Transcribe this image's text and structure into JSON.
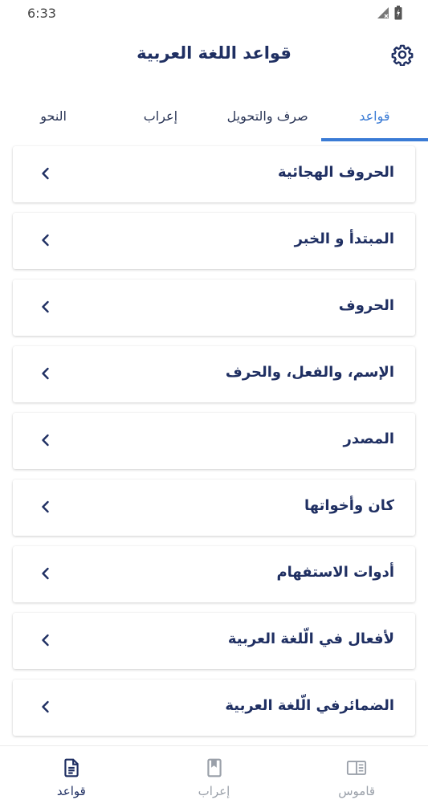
{
  "status": {
    "time": "6:33"
  },
  "app": {
    "title": "قواعد اللغة العربية"
  },
  "tabs": [
    {
      "label": "قواعد",
      "active": true
    },
    {
      "label": "صرف والتحويل",
      "active": false
    },
    {
      "label": "إعراب",
      "active": false
    },
    {
      "label": "النحو",
      "active": false
    }
  ],
  "items": [
    {
      "label": "الحروف الهجائية"
    },
    {
      "label": "المبتدأ و الخبر"
    },
    {
      "label": "الحروف"
    },
    {
      "label": "الإسم، والفعل، والحرف"
    },
    {
      "label": "المصدر"
    },
    {
      "label": "كان وأخواتها"
    },
    {
      "label": "أدوات الاستفهام"
    },
    {
      "label": "لأفعال في الّلغة العربية"
    },
    {
      "label": "الضمائرفي الّلغة العربية"
    }
  ],
  "bottom_nav": [
    {
      "label": "قاموس",
      "icon": "dictionary-icon",
      "active": false
    },
    {
      "label": "إعراب",
      "icon": "bookmark-book-icon",
      "active": false
    },
    {
      "label": "قواعد",
      "icon": "document-icon",
      "active": true
    }
  ],
  "colors": {
    "primary": "#1f2f62",
    "accent": "#3a7bd5",
    "inactive": "#9aa0a9"
  }
}
